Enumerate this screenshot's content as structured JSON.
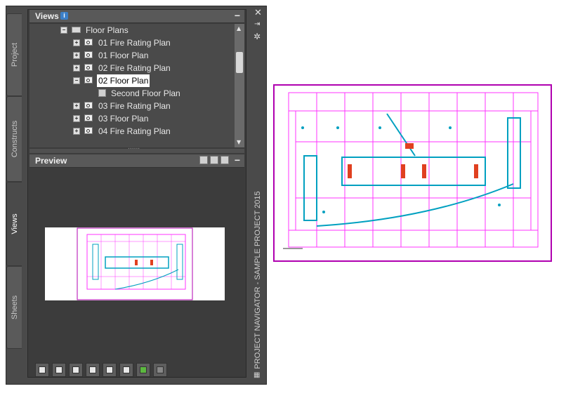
{
  "tabs": [
    {
      "label": "Project",
      "active": false
    },
    {
      "label": "Constructs",
      "active": false
    },
    {
      "label": "Views",
      "active": true
    },
    {
      "label": "Sheets",
      "active": false
    }
  ],
  "views_panel": {
    "title": "Views",
    "collapse": "−"
  },
  "tree": {
    "folder": "Floor Plans",
    "items": [
      {
        "label": "01 Fire Rating Plan",
        "expander": "+"
      },
      {
        "label": "01 Floor Plan",
        "expander": "+"
      },
      {
        "label": "02 Fire Rating Plan",
        "expander": "+"
      },
      {
        "label": "02 Floor Plan",
        "expander": "−",
        "selected": true
      },
      {
        "label": "Second Floor Plan",
        "child": true
      },
      {
        "label": "03 Fire Rating Plan",
        "expander": "+"
      },
      {
        "label": "03 Floor Plan",
        "expander": "+"
      },
      {
        "label": "04 Fire Rating Plan",
        "expander": "+"
      }
    ]
  },
  "preview_panel": {
    "title": "Preview",
    "collapse": "−"
  },
  "palette_title": "PROJECT NAVIGATOR - SAMPLE PROJECT 2015",
  "colors": {
    "accent": "#3c7fc8",
    "plan_outline": "#b000b0",
    "plan_lines": "#ff33ff",
    "plan_cyan": "#00a0c0"
  }
}
